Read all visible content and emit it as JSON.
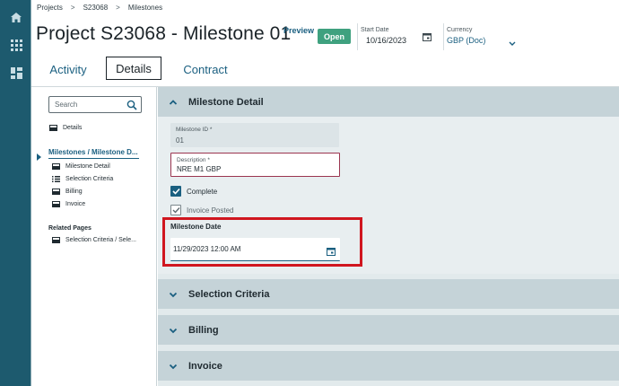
{
  "breadcrumb": [
    "Projects",
    "S23068",
    "Milestones"
  ],
  "breadcrumb_sep": ">",
  "header": {
    "title": "Project S23068 - Milestone 01",
    "preview_label": "Preview",
    "status_badge": "Open",
    "status_color": "#3fa17f",
    "start_date_label": "Start Date",
    "start_date_value": "10/16/2023",
    "currency_label": "Currency",
    "currency_value": "GBP (Doc)"
  },
  "tabs": [
    {
      "label": "Activity",
      "active": false
    },
    {
      "label": "Details",
      "active": true
    },
    {
      "label": "Contract",
      "active": false
    }
  ],
  "leftnav": {
    "search_placeholder": "Search",
    "details_label": "Details",
    "group_label": "Milestones / Milestone D...",
    "children": [
      "Milestone Detail",
      "Selection Criteria",
      "Billing",
      "Invoice"
    ],
    "related_heading": "Related Pages",
    "related_items": [
      "Selection Criteria / Sele..."
    ]
  },
  "sections": [
    {
      "title": "Milestone Detail",
      "expanded": true
    },
    {
      "title": "Selection Criteria",
      "expanded": false
    },
    {
      "title": "Billing",
      "expanded": false
    },
    {
      "title": "Invoice",
      "expanded": false
    }
  ],
  "form": {
    "milestone_id_label": "Milestone ID *",
    "milestone_id_value": "01",
    "description_label": "Description *",
    "description_value": "NRE  M1 GBP",
    "complete_label": "Complete",
    "complete_checked": true,
    "invoice_posted_label": "Invoice Posted",
    "invoice_posted_checked": true,
    "milestone_date_label": "Milestone Date",
    "milestone_date_value": "11/29/2023 12:00 AM"
  },
  "colors": {
    "rail": "#1d5a6e",
    "accent": "#1a5f80",
    "highlight": "#d0161f"
  },
  "icons": {
    "rail": [
      "home-icon",
      "apps-grid-icon",
      "dashboard-icon"
    ],
    "search": "search-icon",
    "calendar": "calendar-icon"
  }
}
